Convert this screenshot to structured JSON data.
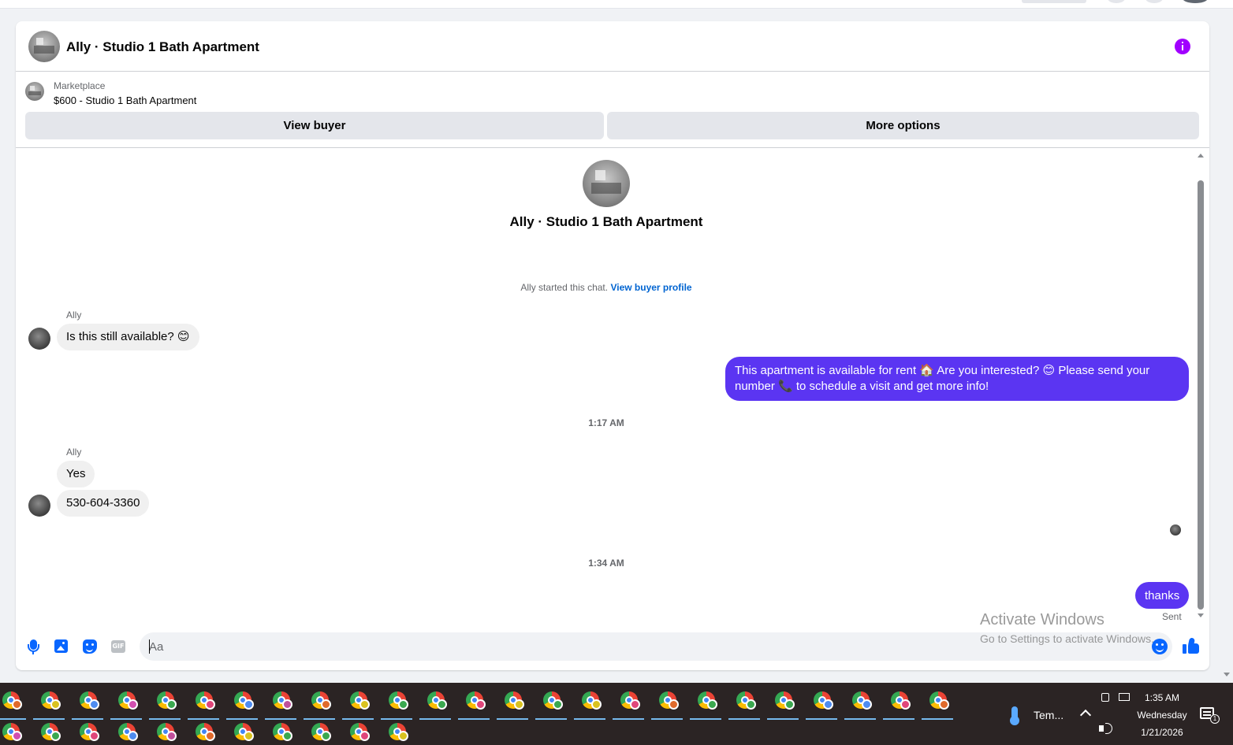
{
  "header": {
    "title": "Ally · Studio 1 Bath Apartment",
    "info_icon": "info-icon",
    "accent": "#a100ff"
  },
  "listing": {
    "category": "Marketplace",
    "price_title": "$600 - Studio 1 Bath Apartment",
    "view_buyer_label": "View buyer",
    "more_options_label": "More options"
  },
  "thread": {
    "title": "Ally · Studio 1 Bath Apartment",
    "started_text": "Ally started this chat.",
    "view_profile_link": "View buyer profile",
    "messages": [
      {
        "sender": "Ally",
        "text": "Is this still available? 😊",
        "direction": "in"
      },
      {
        "text": "This apartment is available for rent 🏠 Are you interested? 😊 Please send your number 📞 to schedule a visit and get more info!",
        "direction": "out"
      },
      {
        "timestamp": "1:17 AM"
      },
      {
        "sender": "Ally",
        "text": "Yes",
        "direction": "in"
      },
      {
        "text": "530-604-3360",
        "direction": "in"
      },
      {
        "timestamp": "1:34 AM"
      },
      {
        "text": "thanks",
        "direction": "out",
        "status": "Sent"
      }
    ],
    "outgoing_color": "#5b35f2",
    "link_color": "#0064d1"
  },
  "composer": {
    "placeholder": "Aa",
    "value": "",
    "icons": [
      "microphone-icon",
      "image-icon",
      "sticker-icon",
      "gif-icon",
      "emoji-icon",
      "thumbs-up-icon"
    ],
    "gif_label": "GIF",
    "icon_color": "#0866ff"
  },
  "watermark": {
    "line1": "Activate Windows",
    "line2": "Go to Settings to activate Windows."
  },
  "taskbar": {
    "time": "1:35 AM",
    "day": "Wednesday",
    "date": "1/21/2026",
    "weather": "Tem...",
    "notification_count": "1",
    "app_icons": [
      "chrome-icon"
    ]
  }
}
